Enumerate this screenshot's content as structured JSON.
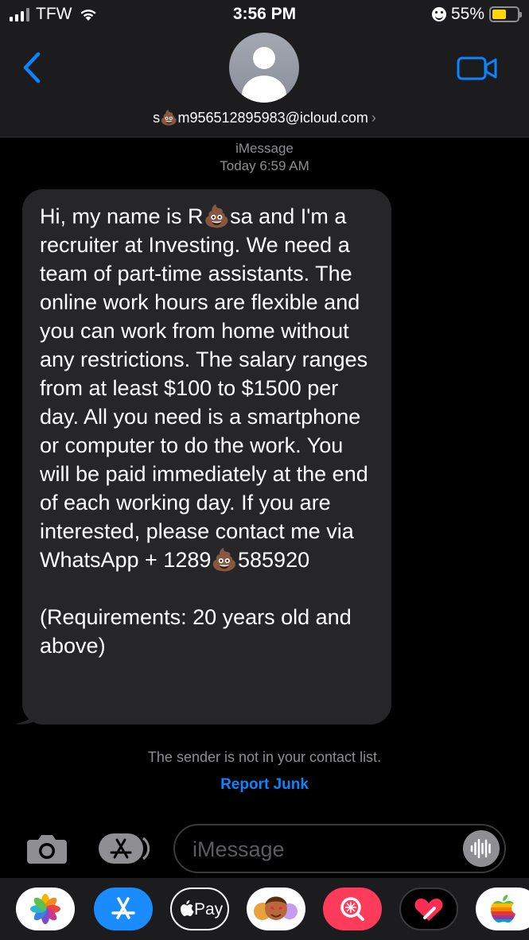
{
  "status_bar": {
    "carrier": "TFW",
    "time": "3:56 PM",
    "battery": "55%",
    "battery_level": 0.55
  },
  "header": {
    "back_icon": "chevron-left-icon",
    "video_icon": "video-camera-icon",
    "avatar_icon": "person-silhouette-icon",
    "contact": "s💩m956512895983@icloud.com",
    "contact_chevron": "›"
  },
  "conversation": {
    "service": "iMessage",
    "timestamp_label": "Today",
    "timestamp_time": "6:59 AM",
    "message": "Hi, my name is R💩sa and I'm a recruiter at Investing. We need a team of part-time assistants. The online work hours are flexible and you can work from home without any restrictions. The salary ranges from at least $100 to $1500 per day. All you need is a smartphone or computer to do the work. You will be paid immediately at the end of each working day. If you are interested, please contact me via WhatsApp + 1289💩585920\n\n(Requirements: 20 years old and above)",
    "sender_note": "The sender is not in your contact list.",
    "report_junk": "Report Junk"
  },
  "input_bar": {
    "camera_icon": "camera-icon",
    "apps_icon": "app-store-icon",
    "placeholder": "iMessage",
    "audio_icon": "audio-waveform-icon"
  },
  "app_drawer": {
    "apps": [
      {
        "icon": "photos-icon"
      },
      {
        "icon": "app-store-icon"
      },
      {
        "icon": "apple-pay-icon",
        "label": "Pay"
      },
      {
        "icon": "memoji-icon"
      },
      {
        "icon": "search-images-icon"
      },
      {
        "icon": "digital-touch-icon"
      },
      {
        "icon": "apple-logo-icon"
      }
    ],
    "accent": "#0a84ff",
    "bubble_color": "#262628"
  }
}
